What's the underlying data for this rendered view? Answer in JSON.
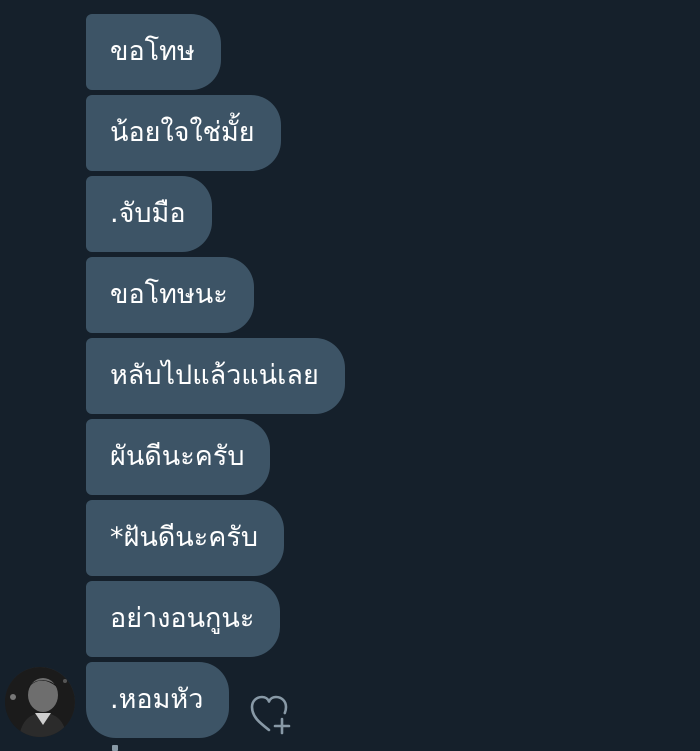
{
  "messages": [
    {
      "text": "ขอโทษ"
    },
    {
      "text": "น้อยใจใช่มั้ย"
    },
    {
      "text": ".จับมือ"
    },
    {
      "text": "ขอโทษนะ"
    },
    {
      "text": "หลับไปแล้วแน่เลย"
    },
    {
      "text": "ผันดีนะครับ"
    },
    {
      "text": "*ฝันดีนะครับ"
    },
    {
      "text": "อย่างอนกูนะ"
    },
    {
      "text": ".หอมหัว"
    }
  ],
  "icons": {
    "avatar": "user-avatar",
    "react": "heart-plus-icon"
  },
  "colors": {
    "background": "#15202b",
    "bubble": "#3d5466",
    "text": "#ffffff",
    "icon": "#8899a6"
  }
}
